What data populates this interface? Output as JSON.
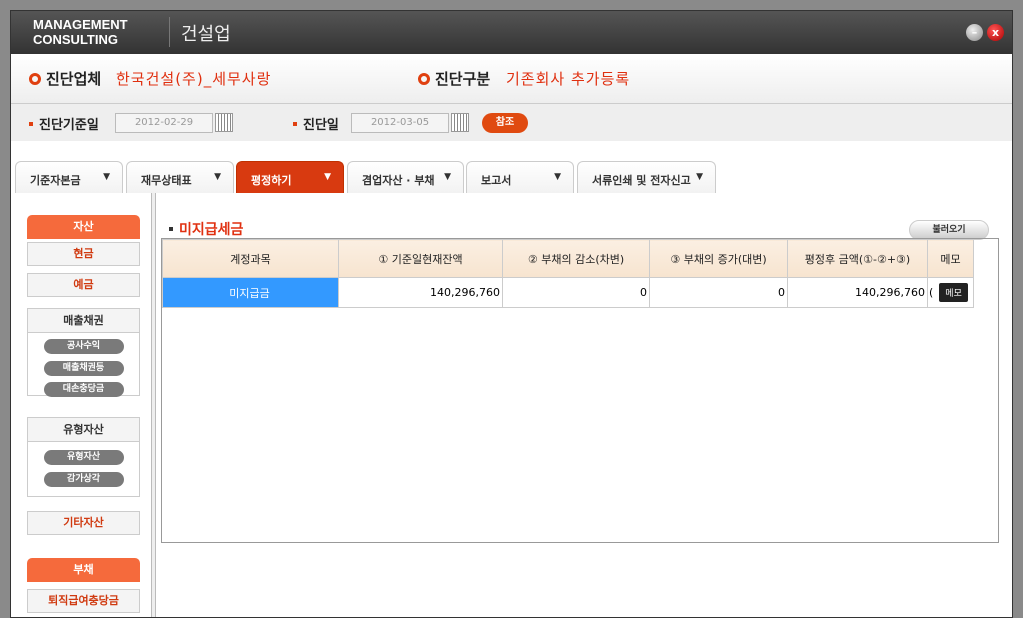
{
  "header": {
    "logo": [
      "MANAGEMENT",
      "CONSULTING"
    ],
    "title": "건설업",
    "minimize": "–",
    "close": "x"
  },
  "info": {
    "company_label": "진단업체",
    "company_value": "한국건설(주)_세무사랑",
    "type_label": "진단구분",
    "type_value": "기존회사 추가등록"
  },
  "dates": {
    "base_label": "진단기준일",
    "base_value": "2012-02-29",
    "diag_label": "진단일",
    "diag_value": "2012-03-05",
    "ref_button": "참조"
  },
  "tabs": [
    {
      "label": "기준자본금"
    },
    {
      "label": "재무상태표"
    },
    {
      "label": "평정하기",
      "active": true
    },
    {
      "label": "겸업자산 · 부채"
    },
    {
      "label": "보고서"
    },
    {
      "label": "서류인쇄 및 전자신고"
    }
  ],
  "sidebar": {
    "asset_header": "자산",
    "cash": "현금",
    "deposit": "예금",
    "receivables": {
      "title": "매출채권",
      "items": [
        "공사수익",
        "매출채권등",
        "대손충당금"
      ]
    },
    "tangible": {
      "title": "유형자산",
      "items": [
        "유형자산",
        "감가상각"
      ]
    },
    "other": "기타자산",
    "liab_header": "부채",
    "retirement": "퇴직급여충당금"
  },
  "main": {
    "title": "미지급세금",
    "load_button": "불러오기",
    "columns": [
      "계정과목",
      "① 기준일현재잔액",
      "② 부채의 감소(차변)",
      "③ 부채의 증가(대변)",
      "평정후 금액(①-②+③)",
      "메모"
    ],
    "rows": [
      {
        "account": "미지급금",
        "base": "140,296,760",
        "decrease": "0",
        "increase": "0",
        "after": "140,296,760",
        "memo_mark": "(",
        "memo_button": "메모"
      }
    ]
  },
  "colors": {
    "accent": "#e03010",
    "selected": "#3399ff",
    "header_bg": "#3a3a3a"
  }
}
